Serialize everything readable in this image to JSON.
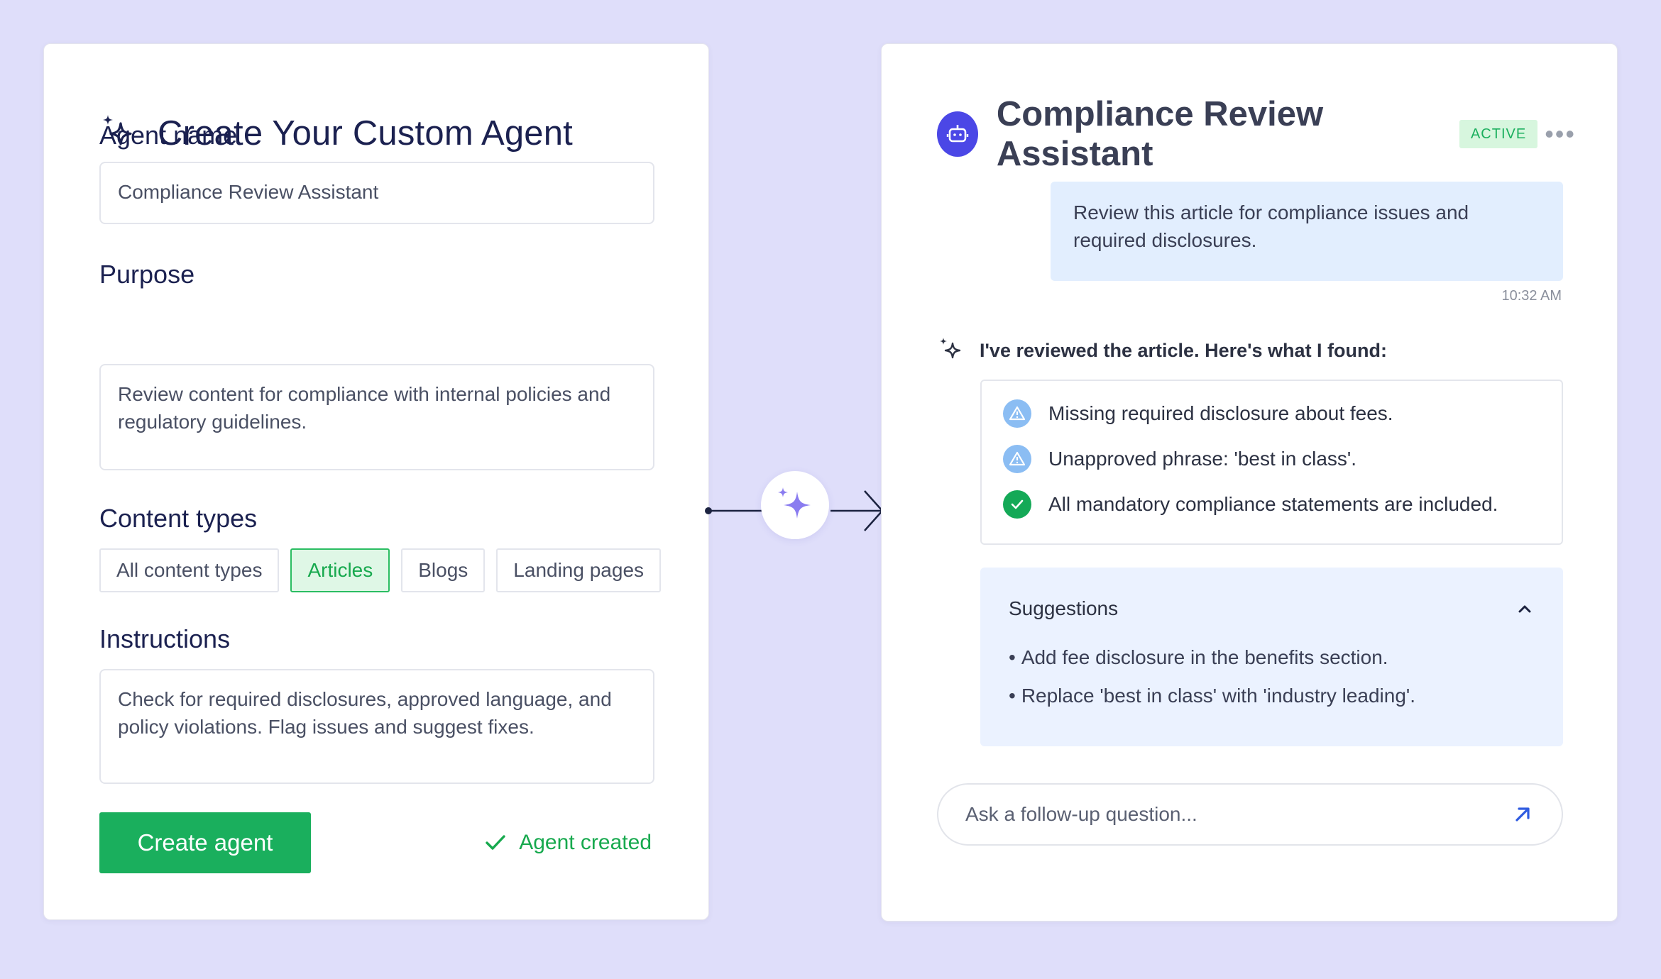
{
  "colors": {
    "background": "#dfdefa",
    "accent_green": "#1aaf5d",
    "bot_purple": "#4b47e6",
    "sparkle_purple": "#8a7cf0",
    "user_bubble": "#e2eefe",
    "suggestions_bg": "#ebf2ff"
  },
  "builder": {
    "icon": "sparkles-icon",
    "title": "Create Your Custom Agent",
    "agent_name_label": "Agent name",
    "agent_name_value": "Compliance Review Assistant",
    "purpose_label": "Purpose",
    "purpose_value": "Review content for compliance with internal policies and regulatory guidelines.",
    "content_types_label": "Content types",
    "content_types": [
      {
        "label": "All content types",
        "selected": false
      },
      {
        "label": "Articles",
        "selected": true
      },
      {
        "label": "Blogs",
        "selected": false
      },
      {
        "label": "Landing pages",
        "selected": false
      }
    ],
    "instructions_label": "Instructions",
    "instructions_value": "Check for required disclosures, approved language, and policy violations. Flag issues and suggest fixes.",
    "create_button": "Create agent",
    "status_text": "Agent created",
    "status_icon": "check-icon"
  },
  "connector": {
    "icon": "sparkle-icon"
  },
  "assistant": {
    "avatar_icon": "robot-icon",
    "title": "Compliance Review Assistant",
    "status_badge": "ACTIVE",
    "more_icon": "more-icon",
    "user_message": "Review this article for compliance issues and required disclosures.",
    "timestamp": "10:32 AM",
    "agent_icon": "sparkles-icon",
    "agent_message": "I've reviewed the article. Here's what I found:",
    "findings": [
      {
        "icon": "warning-icon",
        "status": "warning",
        "text": "Missing required disclosure about fees."
      },
      {
        "icon": "warning-icon",
        "status": "warning",
        "text": "Unapproved phrase: 'best in class'."
      },
      {
        "icon": "check-circle-icon",
        "status": "ok",
        "text": "All mandatory compliance statements are included."
      }
    ],
    "suggestions_title": "Suggestions",
    "suggestions_toggle_icon": "chevron-up-icon",
    "suggestions": [
      "Add fee disclosure in the benefits section.",
      "Replace 'best in class' with 'industry leading'."
    ],
    "followup_placeholder": "Ask a follow-up question...",
    "send_icon": "arrow-up-right-icon"
  }
}
